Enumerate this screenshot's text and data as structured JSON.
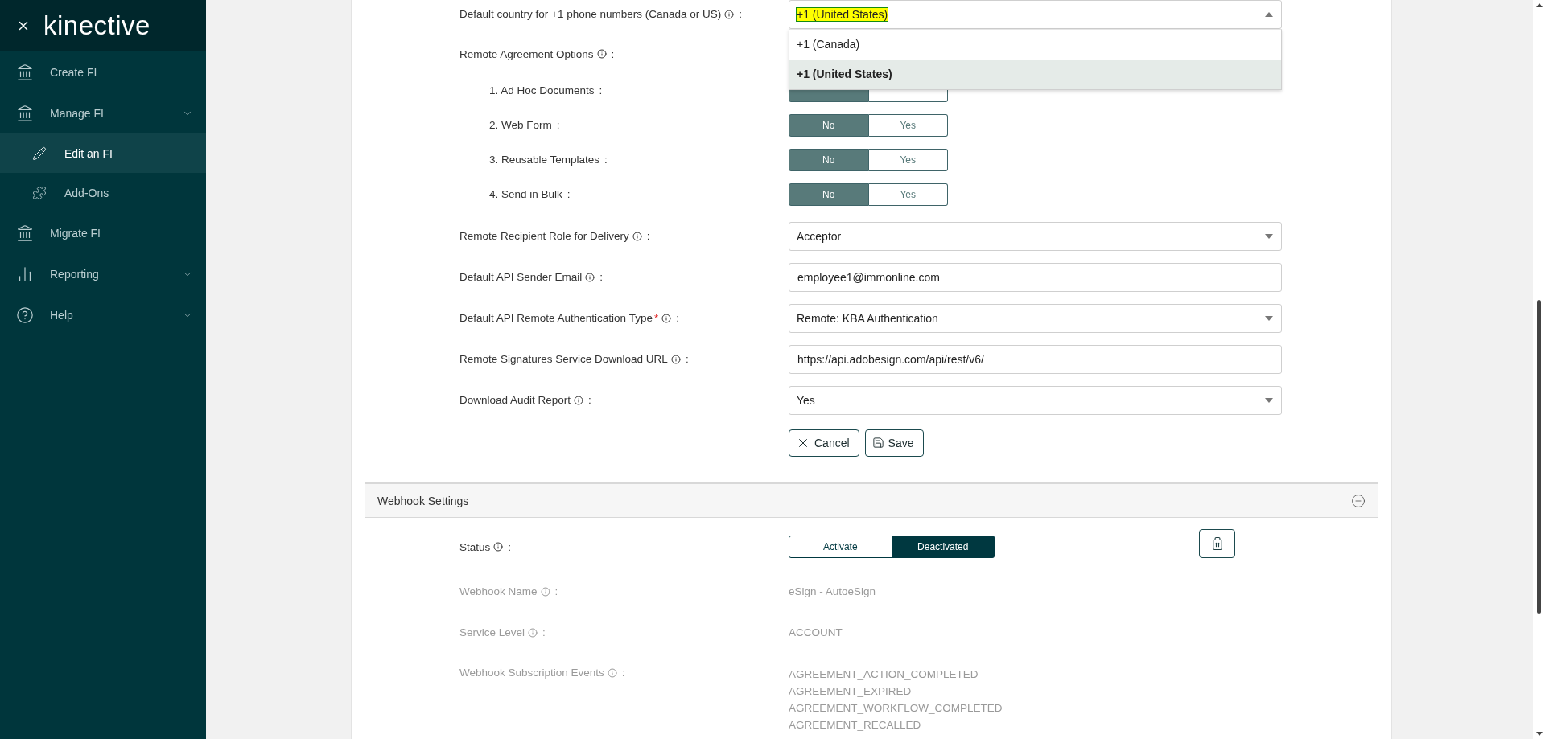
{
  "sidebar": {
    "logo": "kinective",
    "items": [
      {
        "label": "Create FI",
        "selected": false,
        "expandable": false
      },
      {
        "label": "Manage FI",
        "selected": false,
        "expandable": true,
        "children": [
          {
            "label": "Edit an FI",
            "selected": true
          },
          {
            "label": "Add-Ons",
            "selected": false
          }
        ]
      },
      {
        "label": "Migrate FI",
        "selected": false,
        "expandable": false
      },
      {
        "label": "Reporting",
        "selected": false,
        "expandable": true
      },
      {
        "label": "Help",
        "selected": false,
        "expandable": true
      }
    ]
  },
  "form": {
    "fields": [
      {
        "kind": "select",
        "label": "Default country for +1 phone numbers (Canada or US)",
        "info": true,
        "suffix": ":",
        "value": "+1 (United States)",
        "highlighted": true,
        "open": true,
        "options": [
          {
            "label": "+1 (Canada)",
            "selected": false
          },
          {
            "label": "+1 (United States)",
            "selected": true
          }
        ]
      },
      {
        "kind": "heading",
        "label": "Remote Agreement Options",
        "info": true,
        "suffix": ":"
      },
      {
        "kind": "toggle",
        "label": "1. Ad Hoc Documents",
        "info": false,
        "suffix": ":",
        "options": [
          {
            "selected": true
          },
          {
            "selected": false
          }
        ]
      },
      {
        "kind": "toggle",
        "label": "2. Web Form",
        "info": false,
        "suffix": ":",
        "options": [
          {
            "label": "No",
            "selected": true
          },
          {
            "label": "Yes",
            "selected": false
          }
        ]
      },
      {
        "kind": "toggle",
        "label": "3. Reusable Templates",
        "info": false,
        "suffix": ":",
        "options": [
          {
            "label": "No",
            "selected": true
          },
          {
            "label": "Yes",
            "selected": false
          }
        ]
      },
      {
        "kind": "toggle",
        "label": "4. Send in Bulk",
        "info": false,
        "suffix": ":",
        "options": [
          {
            "label": "No",
            "selected": true
          },
          {
            "label": "Yes",
            "selected": false
          }
        ]
      },
      {
        "kind": "select",
        "label": "Remote Recipient Role for Delivery",
        "info": true,
        "suffix": ":",
        "value": "Acceptor",
        "highlighted": false,
        "open": false
      },
      {
        "kind": "text",
        "label": "Default API Sender Email",
        "info": true,
        "suffix": ":",
        "value": "employee1@immonline.com"
      },
      {
        "kind": "select",
        "label": "Default API Remote Authentication Type",
        "required_mark": "*",
        "info": true,
        "suffix": ":",
        "value": "Remote: KBA Authentication",
        "highlighted": false,
        "open": false
      },
      {
        "kind": "text",
        "label": "Remote Signatures Service Download URL",
        "info": true,
        "suffix": ":",
        "value": "https://api.adobesign.com/api/rest/v6/"
      },
      {
        "kind": "select",
        "label": "Download Audit Report",
        "info": true,
        "suffix": ":",
        "value": "Yes",
        "highlighted": false,
        "open": false
      }
    ],
    "buttons": [
      {
        "kind": "cancel",
        "label": "Cancel"
      },
      {
        "kind": "save",
        "label": "Save"
      }
    ]
  },
  "webhook": {
    "title": "Webhook Settings",
    "expanded": true,
    "status": {
      "label": "Status",
      "suffix": ":",
      "options": [
        {
          "label": "Activate",
          "selected": false
        },
        {
          "label": "Deactivated",
          "selected": true
        }
      ]
    },
    "details": [
      {
        "label": "Webhook Name",
        "suffix": ":",
        "disabled": true,
        "values": [
          "eSign - AutoeSign"
        ]
      },
      {
        "label": "Service Level",
        "suffix": ":",
        "disabled": true,
        "values": [
          "ACCOUNT"
        ]
      },
      {
        "label": "Webhook Subscription Events",
        "suffix": ":",
        "disabled": true,
        "values": [
          "AGREEMENT_ACTION_COMPLETED",
          "AGREEMENT_EXPIRED",
          "AGREEMENT_WORKFLOW_COMPLETED",
          "AGREEMENT_RECALLED"
        ]
      }
    ]
  }
}
